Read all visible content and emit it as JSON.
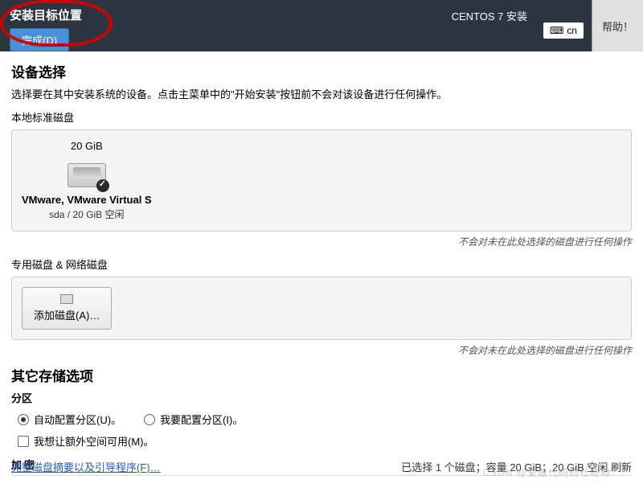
{
  "header": {
    "title": "安装目标位置",
    "done_label": "完成(D)",
    "install_label": "CENTOS 7 安装",
    "keyboard": "cn",
    "help_label": "帮助！"
  },
  "device": {
    "title": "设备选择",
    "description": "选择要在其中安装系统的设备。点击主菜单中的\"开始安装\"按钮前不会对该设备进行任何操作。",
    "local_label": "本地标准磁盘",
    "disk": {
      "size": "20 GiB",
      "name": "VMware, VMware Virtual S",
      "detail": "sda    /    20 GiB 空闲"
    },
    "hint": "不会对未在此处选择的磁盘进行任何操作",
    "special_label": "专用磁盘 & 网络磁盘",
    "add_disk_label": "添加磁盘(A)…"
  },
  "storage": {
    "title": "其它存储选项",
    "partition_label": "分区",
    "auto_label": "自动配置分区(U)。",
    "manual_label": "我要配置分区(I)。",
    "extra_space_label": "我想让额外空间可用(M)。",
    "encrypt_label": "加密"
  },
  "footer": {
    "link": "完整磁盘摘要以及引导程序(F)…",
    "status": "已选择 1 个磁盘；容量 20 GiB；20 GiB 空闲  刷新"
  },
  "watermark": "CSDN @爱敲代码的杜晓帅"
}
